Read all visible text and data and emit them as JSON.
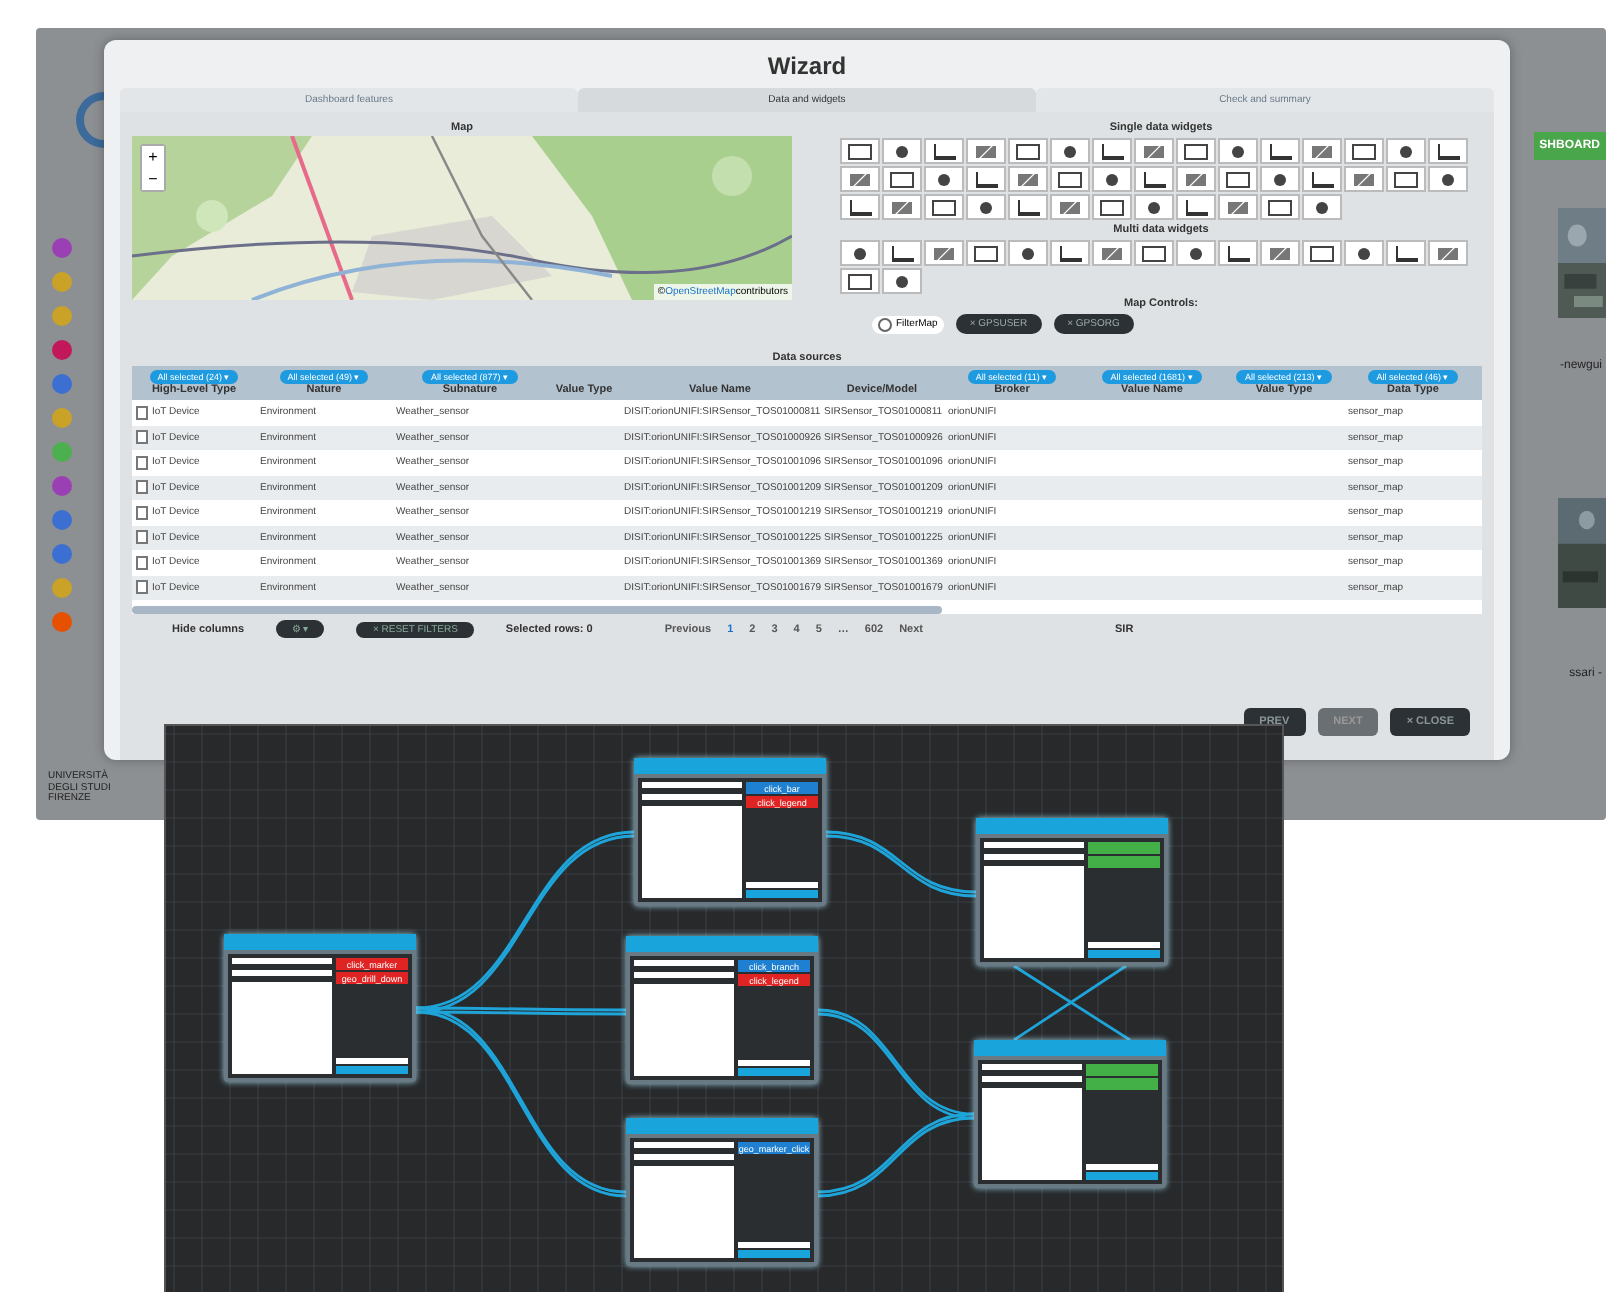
{
  "backdrop": {
    "dashboard_button": "SHBOARD",
    "side_texts": [
      "-newgui",
      "ssari -"
    ],
    "university": "UNIVERSITÀ DEGLI STUDI FIRENZE",
    "sidebar_dots": [
      {
        "color": "#9b3fb5"
      },
      {
        "color": "#c9a227"
      },
      {
        "color": "#c9a227"
      },
      {
        "color": "#c2185b"
      },
      {
        "color": "#3b6fd1"
      },
      {
        "color": "#c9a227"
      },
      {
        "color": "#4caf50"
      },
      {
        "color": "#9b3fb5"
      },
      {
        "color": "#3b6fd1"
      },
      {
        "color": "#3b6fd1"
      },
      {
        "color": "#c9a227"
      },
      {
        "color": "#e65100"
      }
    ]
  },
  "modal": {
    "title": "Wizard",
    "tabs": [
      {
        "label": "Dashboard features",
        "selected": false
      },
      {
        "label": "Data and widgets",
        "selected": true
      },
      {
        "label": "Check and summary",
        "selected": false
      }
    ],
    "map": {
      "title": "Map",
      "zoom_in": "+",
      "zoom_out": "−",
      "attribution_prefix": "©",
      "attribution_link": "OpenStreetMap",
      "attribution": "contributors"
    },
    "single_widgets": {
      "title": "Single data widgets"
    },
    "multi_widgets": {
      "title": "Multi data widgets"
    },
    "map_controls": {
      "title": "Map Controls:",
      "filter": {
        "label": "FilterMap",
        "checked": false
      },
      "chips": [
        "× GPSUSER",
        "× GPSORG"
      ]
    },
    "data_sources": {
      "title": "Data sources",
      "columns": [
        {
          "name": "High-Level Type",
          "filter": "All selected (24) ▾"
        },
        {
          "name": "Nature",
          "filter": "All selected (49) ▾"
        },
        {
          "name": "Subnature",
          "filter": "All selected (877) ▾"
        },
        {
          "name": "Value Type"
        },
        {
          "name": "Value Name"
        },
        {
          "name": "Device/Model"
        },
        {
          "name": "Broker",
          "filter": "All selected (11) ▾"
        },
        {
          "name": "Value Name",
          "filter": "All selected (1681) ▾"
        },
        {
          "name": "Value Type",
          "filter": "All selected (213) ▾"
        },
        {
          "name": "Data Type",
          "filter": "All selected (46) ▾"
        }
      ],
      "rows": [
        {
          "checked": false,
          "type": "IoT Device",
          "nature": "Environment",
          "subnature": "Weather_sensor",
          "value_name": "DISIT:orionUNIFI:SIRSensor_TOS01000811",
          "device": "SIRSensor_TOS01000811",
          "broker": "orionUNIFI",
          "data_type": "sensor_map"
        },
        {
          "checked": false,
          "type": "IoT Device",
          "nature": "Environment",
          "subnature": "Weather_sensor",
          "value_name": "DISIT:orionUNIFI:SIRSensor_TOS01000926",
          "device": "SIRSensor_TOS01000926",
          "broker": "orionUNIFI",
          "data_type": "sensor_map"
        },
        {
          "checked": false,
          "type": "IoT Device",
          "nature": "Environment",
          "subnature": "Weather_sensor",
          "value_name": "DISIT:orionUNIFI:SIRSensor_TOS01001096",
          "device": "SIRSensor_TOS01001096",
          "broker": "orionUNIFI",
          "data_type": "sensor_map"
        },
        {
          "checked": false,
          "type": "IoT Device",
          "nature": "Environment",
          "subnature": "Weather_sensor",
          "value_name": "DISIT:orionUNIFI:SIRSensor_TOS01001209",
          "device": "SIRSensor_TOS01001209",
          "broker": "orionUNIFI",
          "data_type": "sensor_map"
        },
        {
          "checked": false,
          "type": "IoT Device",
          "nature": "Environment",
          "subnature": "Weather_sensor",
          "value_name": "DISIT:orionUNIFI:SIRSensor_TOS01001219",
          "device": "SIRSensor_TOS01001219",
          "broker": "orionUNIFI",
          "data_type": "sensor_map"
        },
        {
          "checked": false,
          "type": "IoT Device",
          "nature": "Environment",
          "subnature": "Weather_sensor",
          "value_name": "DISIT:orionUNIFI:SIRSensor_TOS01001225",
          "device": "SIRSensor_TOS01001225",
          "broker": "orionUNIFI",
          "data_type": "sensor_map"
        },
        {
          "checked": false,
          "type": "IoT Device",
          "nature": "Environment",
          "subnature": "Weather_sensor",
          "value_name": "DISIT:orionUNIFI:SIRSensor_TOS01001369",
          "device": "SIRSensor_TOS01001369",
          "broker": "orionUNIFI",
          "data_type": "sensor_map"
        },
        {
          "checked": false,
          "type": "IoT Device",
          "nature": "Environment",
          "subnature": "Weather_sensor",
          "value_name": "DISIT:orionUNIFI:SIRSensor_TOS01001679",
          "device": "SIRSensor_TOS01001679",
          "broker": "orionUNIFI",
          "data_type": "sensor_map"
        }
      ],
      "hide_columns": "Hide columns",
      "columns_button": "⚙ ▾",
      "reset_button": "× RESET FILTERS",
      "selected_rows": "Selected rows: 0",
      "pages": [
        {
          "label": "Previous",
          "selected": false
        },
        {
          "label": "1",
          "selected": true
        },
        {
          "label": "2",
          "selected": false
        },
        {
          "label": "3",
          "selected": false
        },
        {
          "label": "4",
          "selected": false
        },
        {
          "label": "5",
          "selected": false
        },
        {
          "label": "…",
          "selected": false
        },
        {
          "label": "602",
          "selected": false
        },
        {
          "label": "Next",
          "selected": false
        }
      ],
      "search_term": "SIR"
    },
    "buttons": [
      {
        "label": "PREV",
        "disabled": false
      },
      {
        "label": "NEXT",
        "disabled": true
      },
      {
        "label": "× CLOSE",
        "disabled": false
      }
    ]
  },
  "diagram": {
    "nodes": [
      {
        "buttons": [
          {
            "label": "click_marker",
            "color": "#e02424"
          },
          {
            "label": "geo_drill_down",
            "color": "#e02424"
          }
        ]
      },
      {
        "buttons": [
          {
            "label": "click_bar",
            "color": "#1f7fd0"
          },
          {
            "label": "click_legend",
            "color": "#e02424"
          }
        ]
      },
      {
        "buttons": [
          {
            "label": "click_branch",
            "color": "#1f7fd0"
          },
          {
            "label": "click_legend",
            "color": "#e02424"
          }
        ]
      },
      {
        "buttons": [
          {
            "label": "geo_marker_click",
            "color": "#1f7fd0"
          }
        ]
      },
      {
        "buttons": [
          {
            "color": "#43b047"
          },
          {
            "color": "#43b047"
          }
        ]
      },
      {
        "buttons": [
          {
            "color": "#43b047"
          },
          {
            "color": "#43b047"
          }
        ]
      }
    ]
  }
}
